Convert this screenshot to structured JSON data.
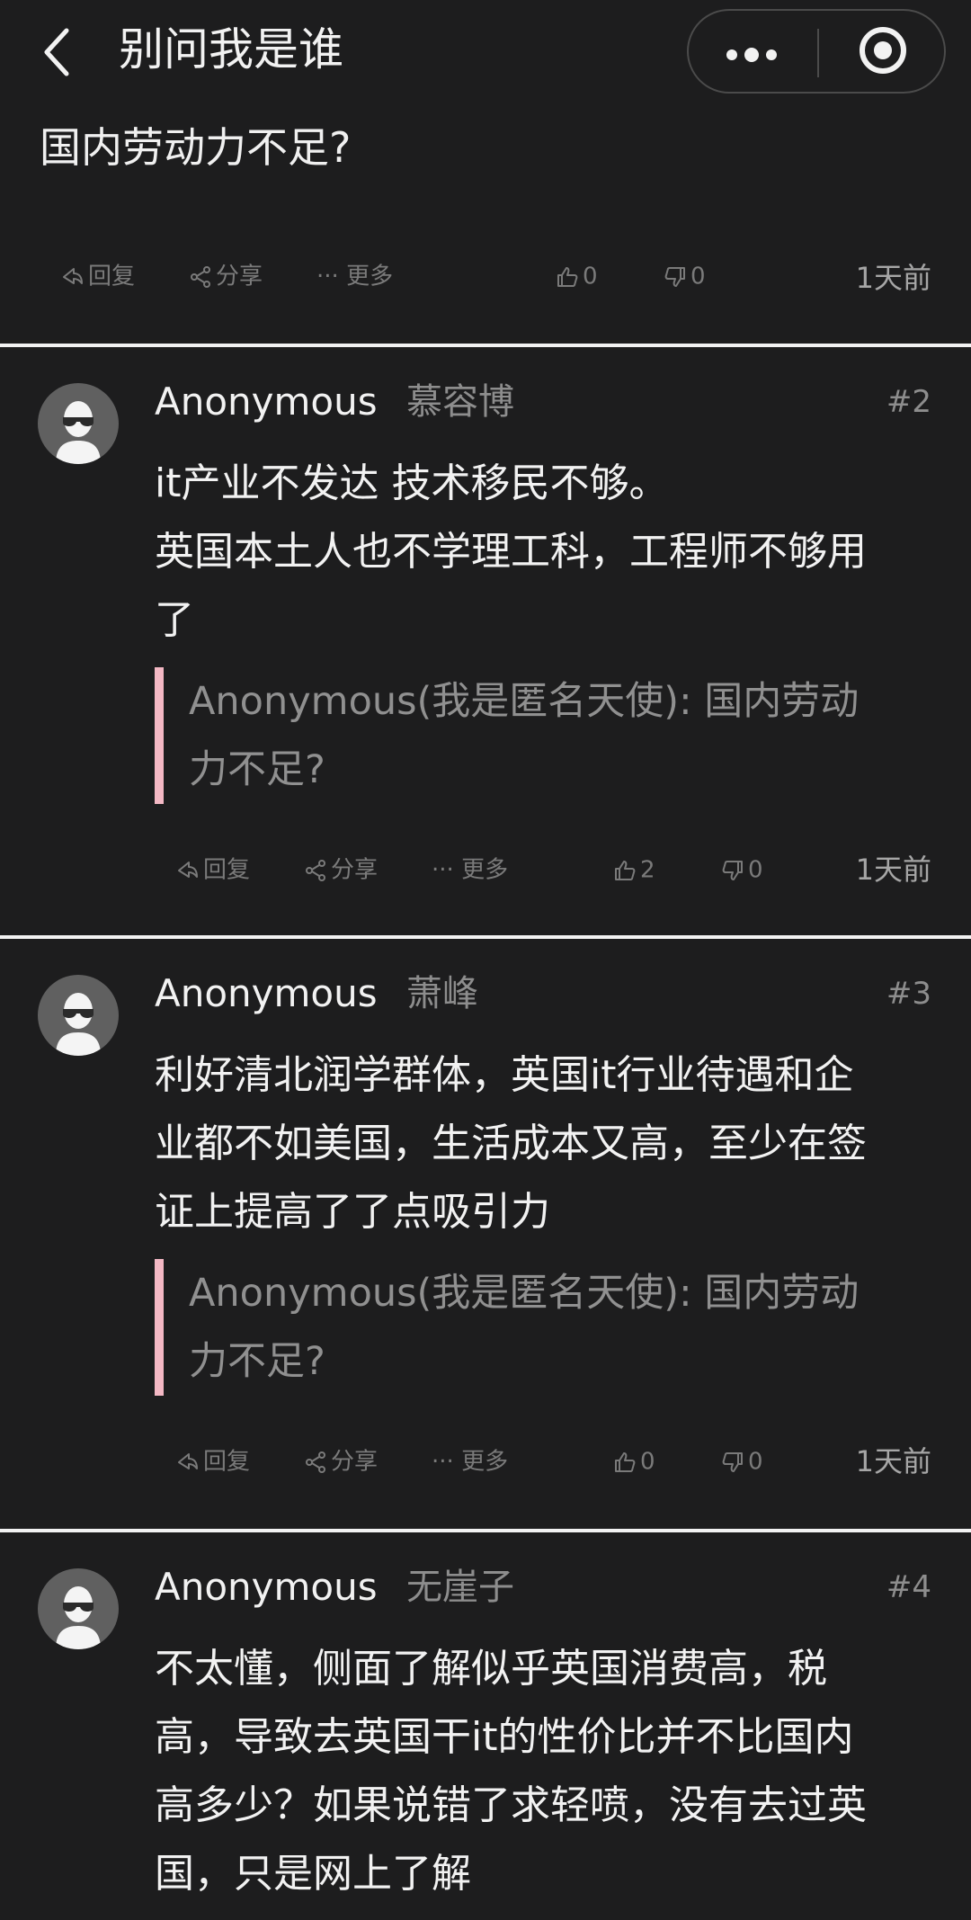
{
  "header": {
    "title": "别问我是谁"
  },
  "question": {
    "text": "国内劳动力不足?"
  },
  "labels": {
    "reply": "回复",
    "share": "分享",
    "more": "更多",
    "more_prefix": "···"
  },
  "op_actions": {
    "likes": "0",
    "dislikes": "0",
    "time": "1天前"
  },
  "posts": [
    {
      "author": "Anonymous",
      "nickname": "慕容博",
      "floor": "#2",
      "lines": [
        "it产业不发达 技术移民不够。",
        "英国本土人也不学理工科，工程师不够用",
        "了"
      ],
      "quote": [
        "Anonymous(我是匿名天使): 国内劳动",
        "力不足?"
      ],
      "likes": "2",
      "dislikes": "0",
      "time": "1天前"
    },
    {
      "author": "Anonymous",
      "nickname": "萧峰",
      "floor": "#3",
      "lines": [
        "利好清北润学群体，英国it行业待遇和企",
        "业都不如美国，生活成本又高，至少在签",
        "证上提高了了点吸引力"
      ],
      "quote": [
        "Anonymous(我是匿名天使): 国内劳动",
        "力不足?"
      ],
      "likes": "0",
      "dislikes": "0",
      "time": "1天前"
    },
    {
      "author": "Anonymous",
      "nickname": "无崖子",
      "floor": "#4",
      "lines": [
        "不太懂，侧面了解似乎英国消费高，税",
        "高，导致去英国干it的性价比并不比国内",
        "高多少？如果说错了求轻喷，没有去过英",
        "国，只是网上了解"
      ]
    }
  ]
}
